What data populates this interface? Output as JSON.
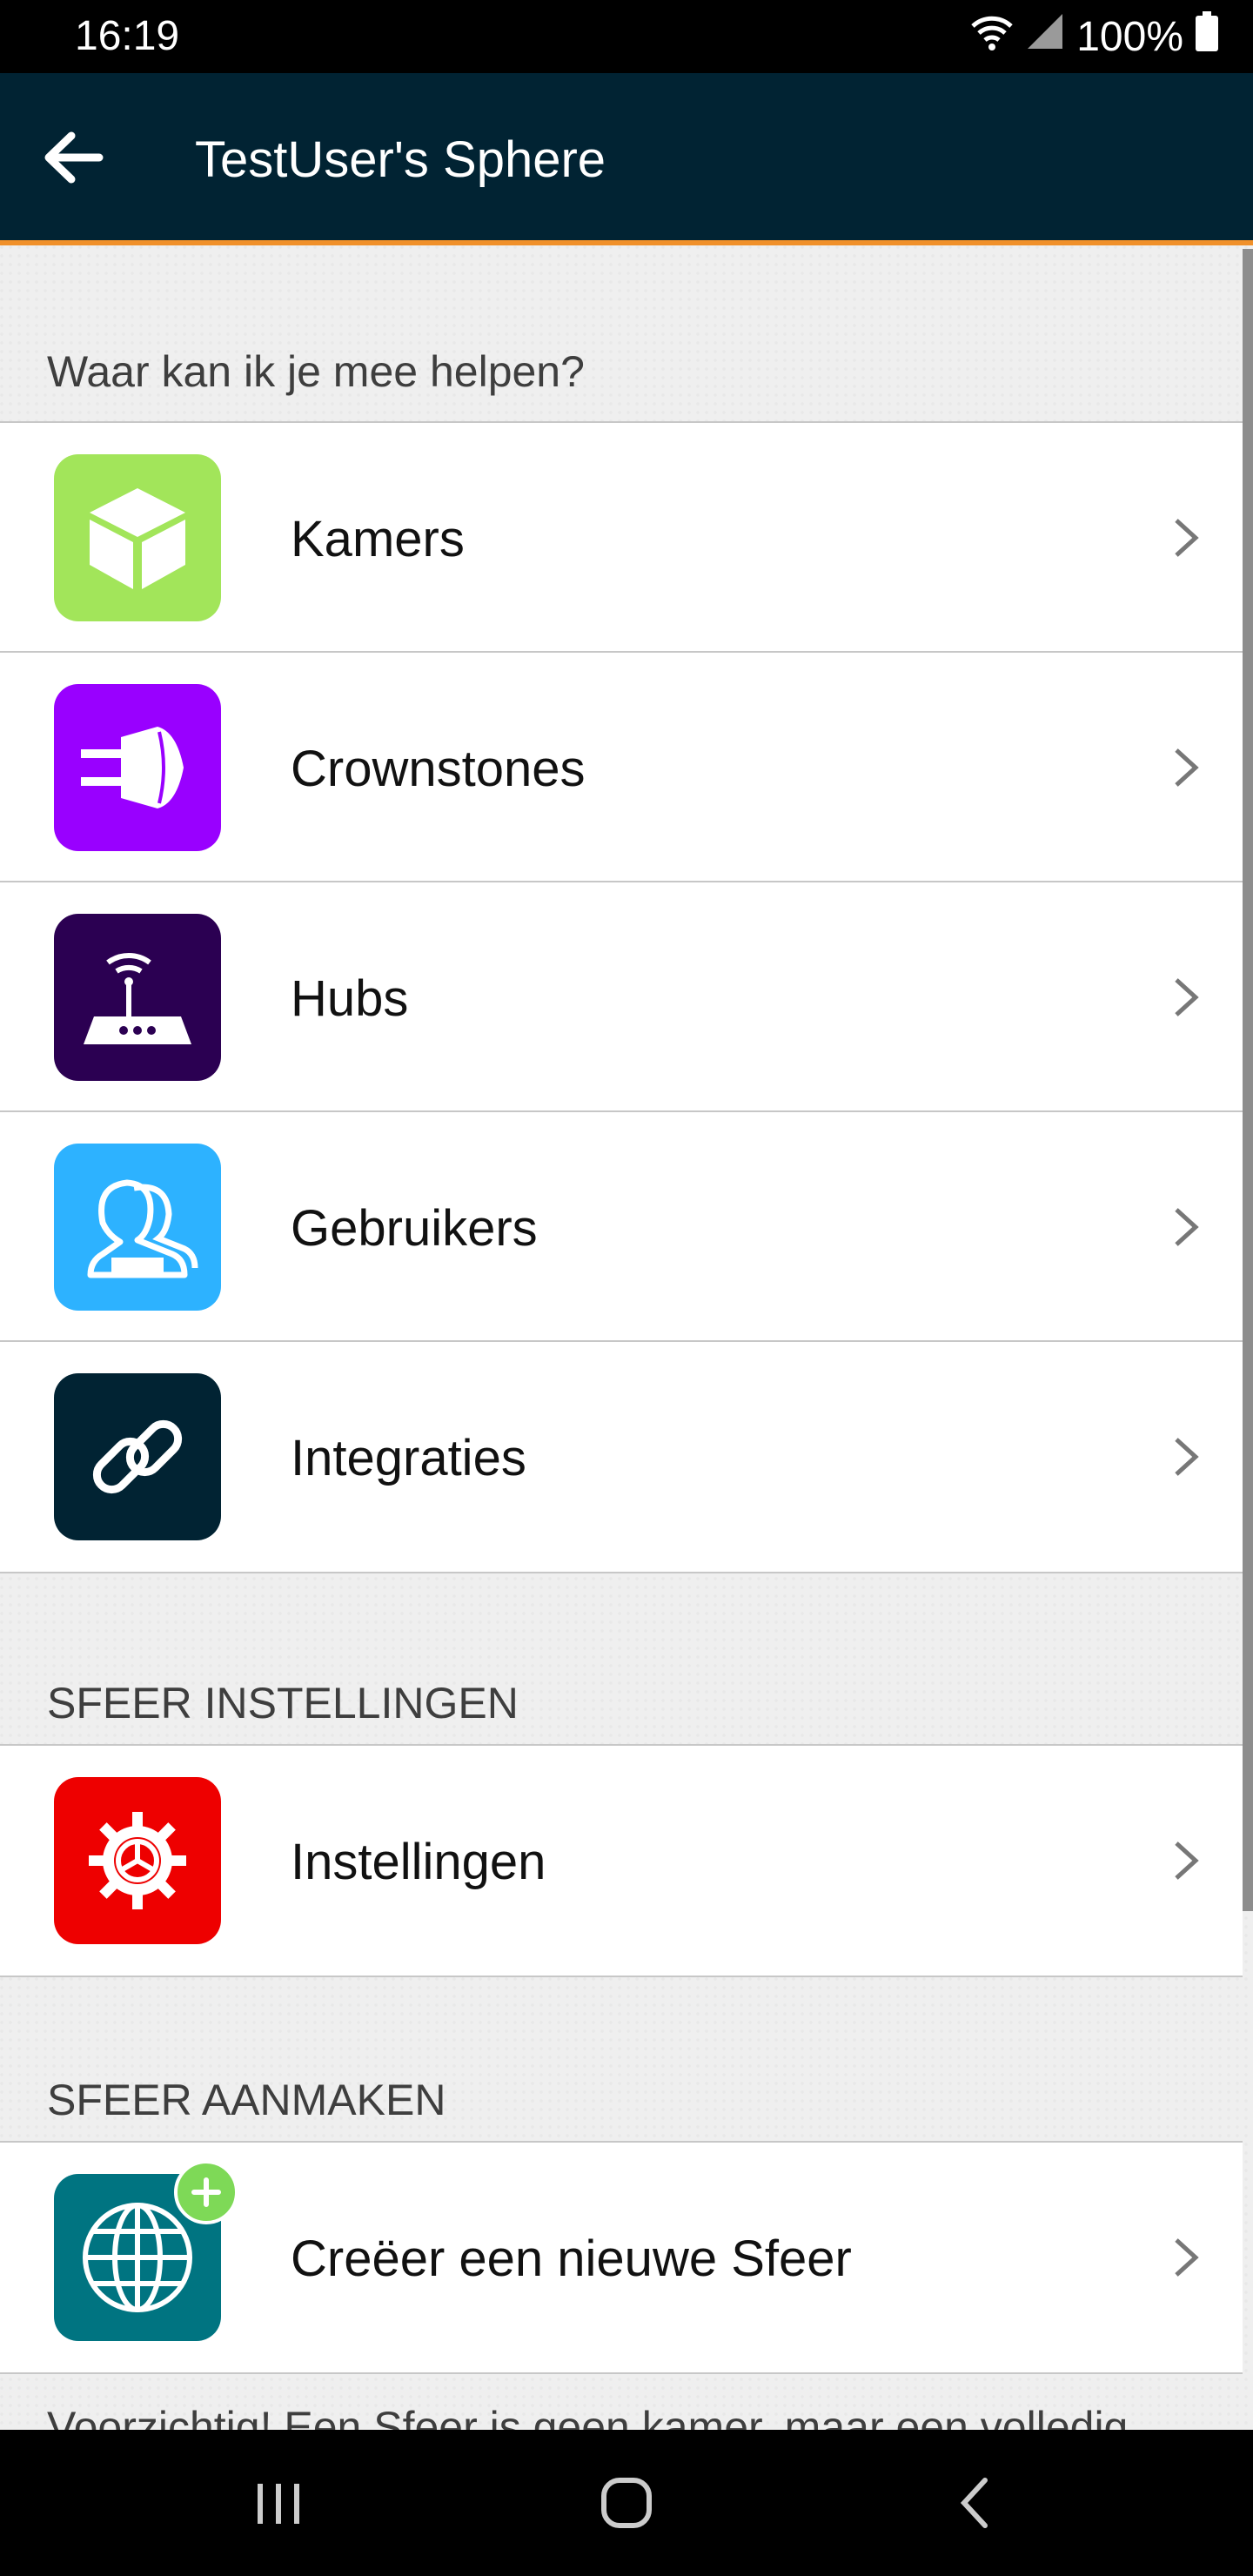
{
  "status_bar": {
    "time": "16:19",
    "battery": "100%",
    "icons": [
      "wifi-icon",
      "signal-icon",
      "battery-icon"
    ]
  },
  "app_bar": {
    "title": "TestUser's Sphere",
    "background": "#012333",
    "accent": "#f0902a"
  },
  "help_section": {
    "label": "Waar kan ik je mee helpen?",
    "items": [
      {
        "label": "Kamers",
        "icon": "cube-icon",
        "color": "#a2e55a"
      },
      {
        "label": "Crownstones",
        "icon": "plug-icon",
        "color": "#9900ff"
      },
      {
        "label": "Hubs",
        "icon": "router-icon",
        "color": "#2b0052"
      },
      {
        "label": "Gebruikers",
        "icon": "users-icon",
        "color": "#2db2ff"
      },
      {
        "label": "Integraties",
        "icon": "link-icon",
        "color": "#012333"
      }
    ]
  },
  "settings_section": {
    "label": "SFEER INSTELLINGEN",
    "items": [
      {
        "label": "Instellingen",
        "icon": "gear-icon",
        "color": "#ee0000"
      }
    ]
  },
  "create_section": {
    "label": "SFEER AANMAKEN",
    "items": [
      {
        "label": "Creëer een nieuwe Sfeer",
        "icon": "globe-plus-icon",
        "color": "#007481"
      }
    ]
  },
  "warning_text": "Voorzichtig! Een Sfeer is geen kamer, maar een volledig"
}
